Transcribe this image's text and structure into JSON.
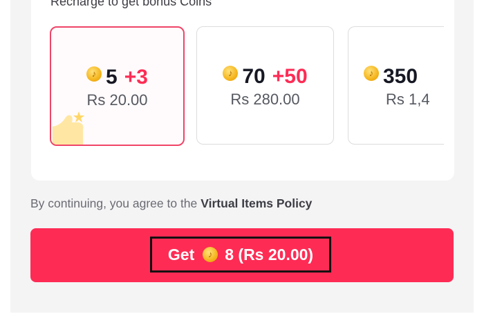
{
  "section": {
    "title": "Recharge to get bonus Coins"
  },
  "packages": [
    {
      "coins": "5",
      "bonus": "+3",
      "price": "Rs 20.00",
      "selected": true
    },
    {
      "coins": "70",
      "bonus": "+50",
      "price": "Rs 280.00",
      "selected": false
    },
    {
      "coins": "350",
      "bonus": "",
      "price": "Rs 1,4",
      "selected": false
    }
  ],
  "policy": {
    "text": "By continuing, you agree to the",
    "link": "Virtual Items Policy"
  },
  "get_button": {
    "prefix": "Get",
    "amount": "8 (Rs 20.00)"
  },
  "icons": {
    "coin": "coin-icon",
    "thumb": "thumbs-up-icon"
  },
  "colors": {
    "accent": "#fe2c55",
    "selected_border": "#ef4468",
    "coin": "#f5b51d"
  }
}
